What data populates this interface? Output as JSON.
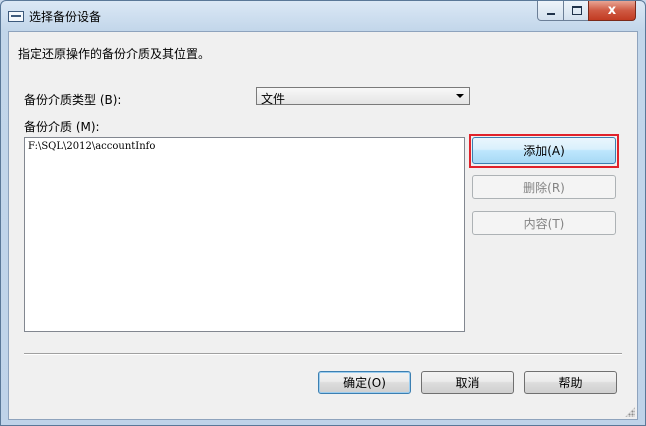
{
  "window": {
    "title": "选择备份设备",
    "minimize_label": "minimize",
    "maximize_label": "maximize",
    "close_label": "x"
  },
  "instruction": "指定还原操作的备份介质及其位置。",
  "media_type": {
    "label": "备份介质类型 (B):",
    "selected": "文件"
  },
  "media_list": {
    "label": "备份介质 (M):",
    "items": [
      "F:\\SQL\\2012\\accountInfo"
    ]
  },
  "side_buttons": {
    "add": "添加(A)",
    "remove": "删除(R)",
    "contents": "内容(T)"
  },
  "footer_buttons": {
    "ok": "确定(O)",
    "cancel": "取消",
    "help": "帮助"
  },
  "colors": {
    "highlight_box": "#e0222b",
    "title_bar": "#c2d6ea",
    "client_bg": "#f0f0f0"
  }
}
